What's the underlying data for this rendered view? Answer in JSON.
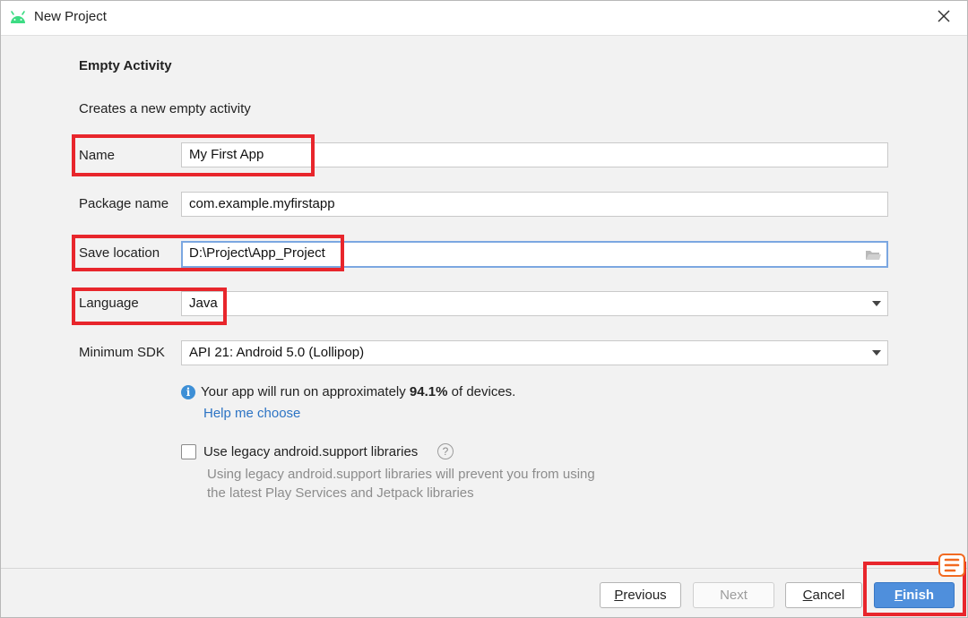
{
  "window": {
    "title": "New Project",
    "app_icon": "android-icon",
    "close_icon": "close-icon"
  },
  "page": {
    "heading": "Empty Activity",
    "description": "Creates a new empty activity"
  },
  "fields": {
    "name": {
      "label": "Name",
      "value": "My First App"
    },
    "package": {
      "label": "Package name",
      "value": "com.example.myfirstapp"
    },
    "save_location": {
      "label": "Save location",
      "value": "D:\\Project\\App_Project",
      "icon": "folder-icon"
    },
    "language": {
      "label": "Language",
      "value": "Java"
    },
    "min_sdk": {
      "label": "Minimum SDK",
      "value": "API 21: Android 5.0 (Lollipop)"
    }
  },
  "info": {
    "text_before": "Your app will run on approximately ",
    "percent": "94.1%",
    "text_after": " of devices.",
    "link": "Help me choose"
  },
  "legacy": {
    "label": "Use legacy android.support libraries",
    "checked": false,
    "desc_line1": "Using legacy android.support libraries will prevent you from using",
    "desc_line2": "the latest Play Services and Jetpack libraries"
  },
  "buttons": {
    "previous": "Previous",
    "next": "Next",
    "cancel": "Cancel",
    "finish": "Finish"
  },
  "colors": {
    "highlight": "#e8262c",
    "primary": "#4f8fdc",
    "link": "#2d74c4",
    "android": "#3ddc84"
  }
}
